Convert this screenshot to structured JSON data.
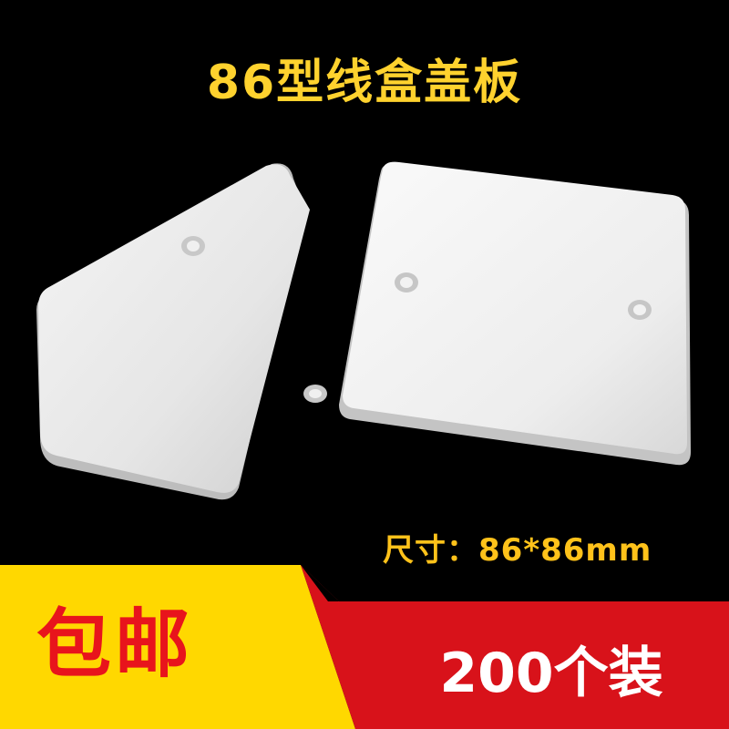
{
  "title": "86型线盒盖板",
  "size_label": "尺寸：86*86mm",
  "promo": {
    "free_shipping": "包邮",
    "quantity": "200个装"
  },
  "colors": {
    "title": "#ffd22e",
    "size": "#ffc21a",
    "yellow_band": "#ffd800",
    "red_band": "#d8121a",
    "promo_text_red": "#e8141c"
  }
}
